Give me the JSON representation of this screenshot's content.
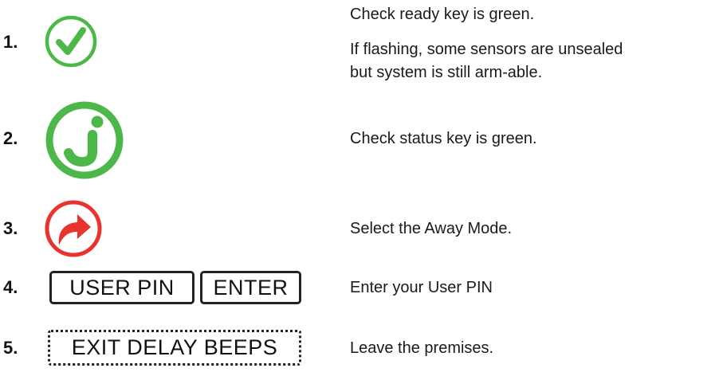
{
  "steps": [
    {
      "number": "1.",
      "icon": "ready-check-icon",
      "lines": [
        "Check ready key is green.",
        "If flashing, some sensors are unsealed",
        "but system is still arm-able."
      ]
    },
    {
      "number": "2.",
      "icon": "status-info-icon",
      "lines": [
        "Check status key is green."
      ]
    },
    {
      "number": "3.",
      "icon": "away-mode-arrow-icon",
      "lines": [
        "Select the Away Mode."
      ]
    },
    {
      "number": "4.",
      "keys": [
        "USER PIN",
        "ENTER"
      ],
      "lines": [
        "Enter your User PIN"
      ]
    },
    {
      "number": "5.",
      "indicator": "EXIT DELAY BEEPS",
      "lines": [
        "Leave the premises."
      ]
    }
  ],
  "colors": {
    "green": "#4cb84a",
    "red": "#e8332f",
    "text": "#1a1a1a"
  }
}
